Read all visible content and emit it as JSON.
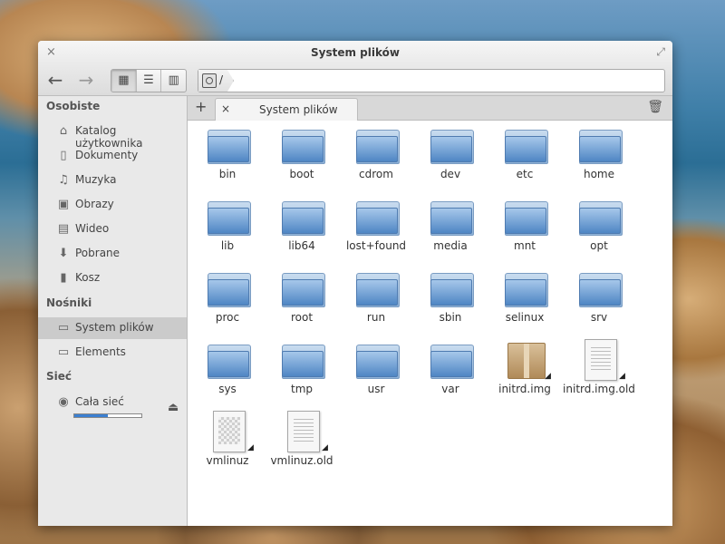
{
  "window": {
    "title": "System plików",
    "close_glyph": "×",
    "maximize_glyph": "⤢"
  },
  "toolbar": {
    "back_glyph": "←",
    "forward_glyph": "→",
    "view_icons": "▦",
    "view_list": "☰",
    "view_columns": "▥",
    "path": "/"
  },
  "sidebar": {
    "personal_heading": "Osobiste",
    "personal_items": [
      {
        "label": "Katalog użytkownika",
        "icon": "home-icon",
        "glyph": "⌂"
      },
      {
        "label": "Dokumenty",
        "icon": "document-icon",
        "glyph": "▯"
      },
      {
        "label": "Muzyka",
        "icon": "music-icon",
        "glyph": "♫"
      },
      {
        "label": "Obrazy",
        "icon": "picture-icon",
        "glyph": "▣"
      },
      {
        "label": "Wideo",
        "icon": "video-icon",
        "glyph": "▤"
      },
      {
        "label": "Pobrane",
        "icon": "download-icon",
        "glyph": "⬇"
      },
      {
        "label": "Kosz",
        "icon": "trash-icon",
        "glyph": "▮"
      }
    ],
    "devices_heading": "Nośniki",
    "devices_items": [
      {
        "label": "System plików",
        "icon": "filesystem-icon",
        "glyph": "▭",
        "selected": true
      },
      {
        "label": "Elements",
        "icon": "drive-icon",
        "glyph": "▭",
        "usage": 0.5
      }
    ],
    "eject_glyph": "⏏",
    "network_heading": "Sieć",
    "network_items": [
      {
        "label": "Cała sieć",
        "icon": "network-icon",
        "glyph": "◉"
      }
    ]
  },
  "tabs": {
    "add_glyph": "+",
    "close_glyph": "×",
    "active_label": "System plików",
    "trash_glyph": "🗑"
  },
  "files": [
    {
      "name": "bin",
      "type": "folder"
    },
    {
      "name": "boot",
      "type": "folder"
    },
    {
      "name": "cdrom",
      "type": "folder"
    },
    {
      "name": "dev",
      "type": "folder"
    },
    {
      "name": "etc",
      "type": "folder"
    },
    {
      "name": "home",
      "type": "folder"
    },
    {
      "name": "lib",
      "type": "folder"
    },
    {
      "name": "lib64",
      "type": "folder"
    },
    {
      "name": "lost+found",
      "type": "folder"
    },
    {
      "name": "media",
      "type": "folder"
    },
    {
      "name": "mnt",
      "type": "folder"
    },
    {
      "name": "opt",
      "type": "folder"
    },
    {
      "name": "proc",
      "type": "folder"
    },
    {
      "name": "root",
      "type": "folder"
    },
    {
      "name": "run",
      "type": "folder"
    },
    {
      "name": "sbin",
      "type": "folder"
    },
    {
      "name": "selinux",
      "type": "folder"
    },
    {
      "name": "srv",
      "type": "folder"
    },
    {
      "name": "sys",
      "type": "folder"
    },
    {
      "name": "tmp",
      "type": "folder"
    },
    {
      "name": "usr",
      "type": "folder"
    },
    {
      "name": "var",
      "type": "folder"
    },
    {
      "name": "initrd.img",
      "type": "package",
      "link": true
    },
    {
      "name": "initrd.img.old",
      "type": "text",
      "link": true
    },
    {
      "name": "vmlinuz",
      "type": "binary",
      "link": true
    },
    {
      "name": "vmlinuz.old",
      "type": "text",
      "link": true
    }
  ]
}
